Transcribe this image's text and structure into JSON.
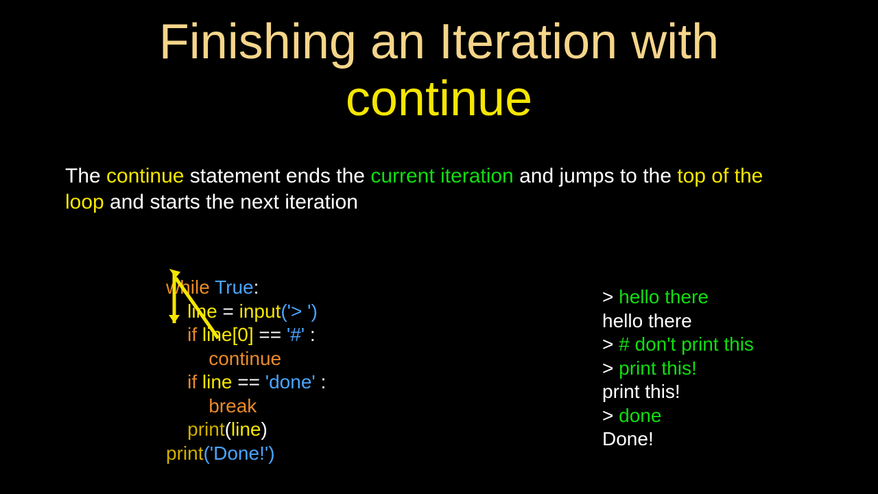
{
  "title": {
    "line1": "Finishing an Iteration with",
    "line2": "continue"
  },
  "body": {
    "p1": "The ",
    "p2": "continue",
    "p3": " statement ends the ",
    "p4": "current iteration",
    "p5": " and jumps to the ",
    "p6": "top of the loop",
    "p7": " and starts the next iteration"
  },
  "code": {
    "l1_kw": "while ",
    "l1_lit": "True",
    "l1_rest": ":",
    "l2_var": "line",
    "l2_mid": " = ",
    "l2_fn": "input",
    "l2_arg": "('> ')",
    "l3_kw": "if ",
    "l3_var": "line[0]",
    "l3_mid": " == ",
    "l3_lit": "'#'",
    "l3_end": " :",
    "l4_kw": "continue",
    "l5_kw": "if ",
    "l5_var": "line",
    "l5_mid": " == ",
    "l5_lit": "'done'",
    "l5_end": " :",
    "l6_kw": "break",
    "l7_fn": "print",
    "l7_open": "(",
    "l7_var": "line",
    "l7_close": ")",
    "l8_fn": "print",
    "l8_arg": "('Done!')",
    "indent1": "    ",
    "indent2": "        "
  },
  "output": {
    "l1a": "> ",
    "l1b": "hello there",
    "l2": "hello there",
    "l3a": "> ",
    "l3b": "# don't print this",
    "l4a": "> ",
    "l4b": "print this!",
    "l5": "print this!",
    "l6a": "> ",
    "l6b": "done",
    "l7": "Done!"
  }
}
